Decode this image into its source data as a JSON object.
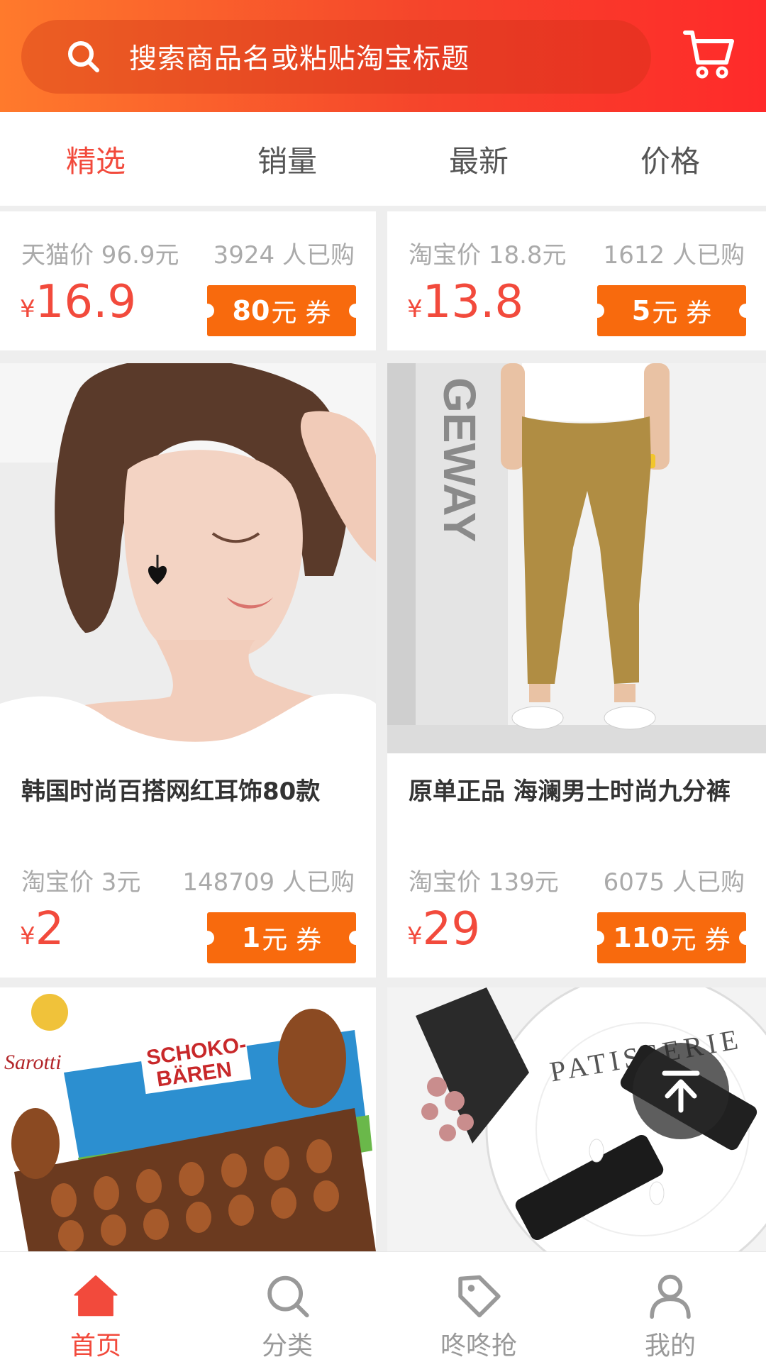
{
  "search": {
    "placeholder": "搜索商品名或粘贴淘宝标题"
  },
  "tabs": [
    {
      "label": "精选",
      "active": true
    },
    {
      "label": "销量",
      "active": false
    },
    {
      "label": "最新",
      "active": false
    },
    {
      "label": "价格",
      "active": false
    }
  ],
  "products": [
    {
      "orig_price": "天猫价 96.9元",
      "sold": "3924 人已购",
      "currency": "¥",
      "price": "16.9",
      "coupon_amount": "80",
      "coupon_unit": "元",
      "coupon_word": "券"
    },
    {
      "orig_price": "淘宝价 18.8元",
      "sold": "1612 人已购",
      "currency": "¥",
      "price": "13.8",
      "coupon_amount": "5",
      "coupon_unit": "元",
      "coupon_word": "券"
    },
    {
      "title": "韩国时尚百搭网红耳饰80款",
      "orig_price": "淘宝价 3元",
      "sold": "148709 人已购",
      "currency": "¥",
      "price": "2",
      "coupon_amount": "1",
      "coupon_unit": "元",
      "coupon_word": "券"
    },
    {
      "title": "原单正品 海澜男士时尚九分裤",
      "orig_price": "淘宝价 139元",
      "sold": "6075 人已购",
      "currency": "¥",
      "price": "29",
      "coupon_amount": "110",
      "coupon_unit": "元",
      "coupon_word": "券"
    }
  ],
  "image_text": {
    "brand": "Sarotti",
    "product_line1": "SCHOKO-",
    "product_line2": "BÄREN",
    "wall_text": "GEWAY",
    "plate_text": "PATISSERIE"
  },
  "bottom_nav": [
    {
      "label": "首页",
      "icon": "home-icon",
      "active": true
    },
    {
      "label": "分类",
      "icon": "search-icon",
      "active": false
    },
    {
      "label": "咚咚抢",
      "icon": "tag-icon",
      "active": false
    },
    {
      "label": "我的",
      "icon": "user-icon",
      "active": false
    }
  ],
  "colors": {
    "accent": "#f24a3c",
    "coupon": "#f86a0d",
    "header_start": "#ff7a2c",
    "header_end": "#ff2a2a"
  }
}
